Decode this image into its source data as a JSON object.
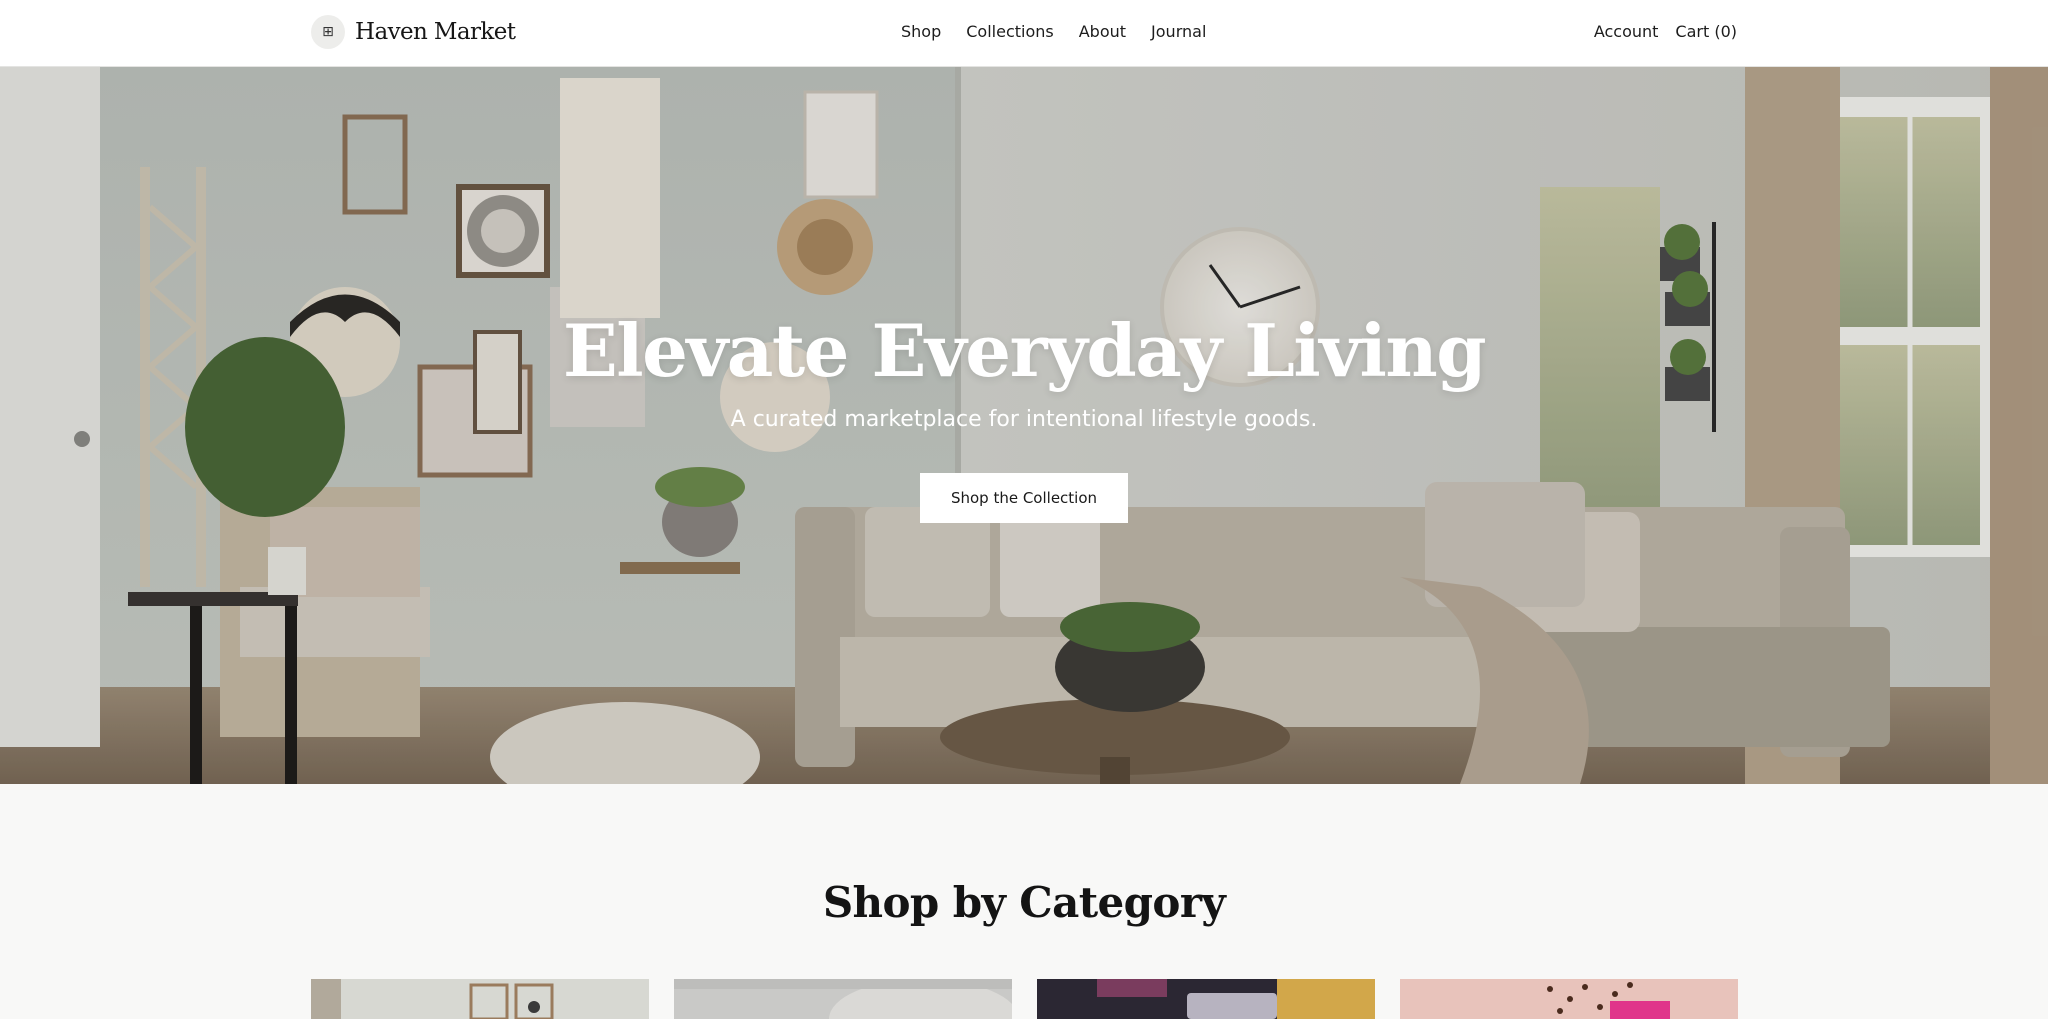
{
  "brand": {
    "name": "Haven Market",
    "logo_icon": "grid-icon"
  },
  "nav": {
    "items": [
      {
        "label": "Shop"
      },
      {
        "label": "Collections"
      },
      {
        "label": "About"
      },
      {
        "label": "Journal"
      }
    ]
  },
  "utility": {
    "account_label": "Account",
    "cart_label": "Cart (0)"
  },
  "hero": {
    "title": "Elevate Everyday Living",
    "subtitle": "A curated marketplace for intentional lifestyle goods.",
    "cta_label": "Shop the Collection"
  },
  "categories": {
    "title": "Shop by Category"
  },
  "colors": {
    "header_bg": "#ffffff",
    "page_bg": "#f8f8f7",
    "text": "#1a1a1a",
    "hero_text": "#ffffff"
  }
}
